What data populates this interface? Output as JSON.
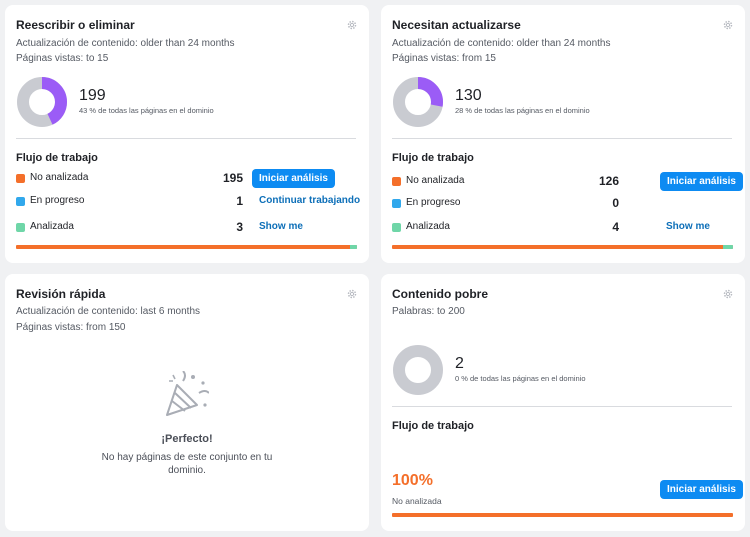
{
  "colors": {
    "not_analyzed": "#f46f2a",
    "in_progress": "#31a8ec",
    "analyzed": "#6fd6a8",
    "purple": "#9b5cf6",
    "gray_ring": "#c9cbd1",
    "button": "#0d8bf2",
    "link": "#0d6fb8"
  },
  "cards": [
    {
      "title": "Reescribir o eliminar",
      "meta1": "Actualización de contenido: older than 24 months",
      "meta2": "Páginas vistas: to 15",
      "count": "199",
      "pct_text": "43 % de todas las páginas en el dominio",
      "ring_fraction": 0.43,
      "workflow_title": "Flujo de trabajo",
      "rows": [
        {
          "label": "No analizada",
          "value": "195",
          "action": "Iniciar análisis"
        },
        {
          "label": "En progreso",
          "value": "1",
          "action": "Continuar trabajando"
        },
        {
          "label": "Analizada",
          "value": "3",
          "action": "Show me"
        }
      ],
      "progress": {
        "not_analyzed": 195,
        "in_progress": 1,
        "analyzed": 3
      }
    },
    {
      "title": "Necesitan actualizarse",
      "meta1": "Actualización de contenido: older than 24 months",
      "meta2": "Páginas vistas: from 15",
      "count": "130",
      "pct_text": "28 % de todas las páginas en el dominio",
      "ring_fraction": 0.28,
      "workflow_title": "Flujo de trabajo",
      "rows": [
        {
          "label": "No analizada",
          "value": "126",
          "action": "Iniciar análisis"
        },
        {
          "label": "En progreso",
          "value": "0",
          "action": ""
        },
        {
          "label": "Analizada",
          "value": "4",
          "action": "Show me"
        }
      ],
      "progress": {
        "not_analyzed": 126,
        "in_progress": 0,
        "analyzed": 4
      }
    },
    {
      "title": "Revisión rápida",
      "meta1": "Actualización de contenido: last 6 months",
      "meta2": "Páginas vistas: from 150",
      "empty_title": "¡Perfecto!",
      "empty_text": "No hay páginas de este conjunto en tu dominio."
    },
    {
      "title": "Contenido pobre",
      "meta1": "Palabras: to 200",
      "count": "2",
      "pct_text": "0 % de todas las páginas en el dominio",
      "ring_fraction": 0,
      "workflow_title": "Flujo de trabajo",
      "big_pct": "100%",
      "big_sub": "No analizada",
      "action": "Iniciar análisis",
      "progress": {
        "not_analyzed": 1,
        "in_progress": 0,
        "analyzed": 0
      }
    }
  ]
}
